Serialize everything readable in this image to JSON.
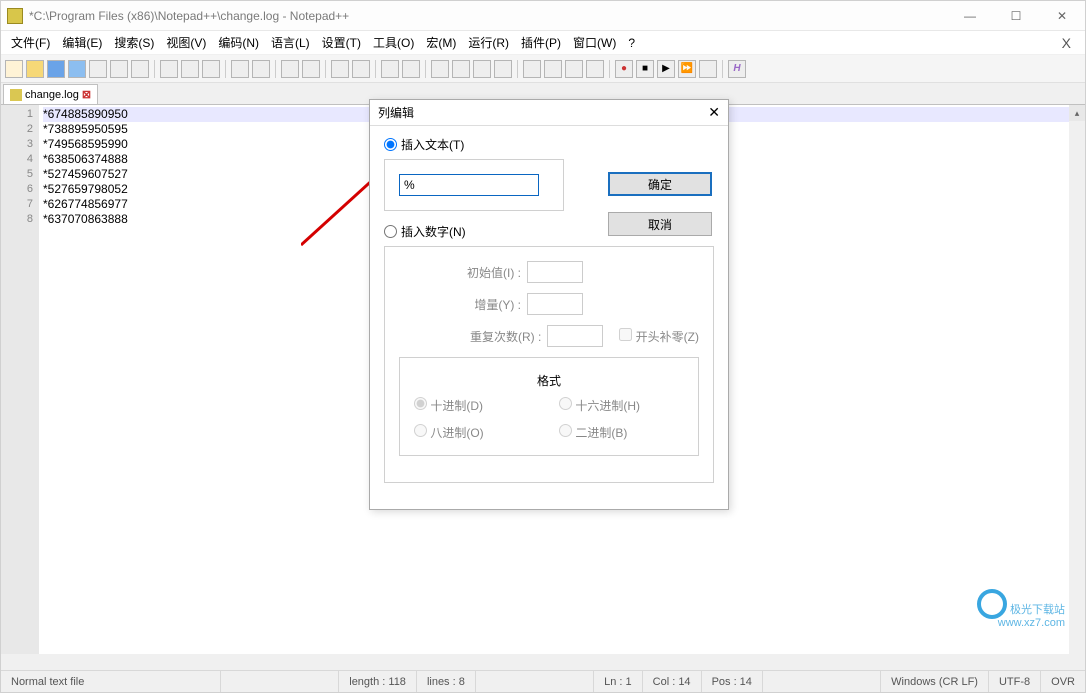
{
  "titlebar": {
    "title": "*C:\\Program Files (x86)\\Notepad++\\change.log - Notepad++"
  },
  "menus": [
    {
      "label": "文件(F)"
    },
    {
      "label": "编辑(E)"
    },
    {
      "label": "搜索(S)"
    },
    {
      "label": "视图(V)"
    },
    {
      "label": "编码(N)"
    },
    {
      "label": "语言(L)"
    },
    {
      "label": "设置(T)"
    },
    {
      "label": "工具(O)"
    },
    {
      "label": "宏(M)"
    },
    {
      "label": "运行(R)"
    },
    {
      "label": "插件(P)"
    },
    {
      "label": "窗口(W)"
    },
    {
      "label": "?"
    }
  ],
  "tab": {
    "name": "change.log"
  },
  "code_lines": [
    "*674885890950",
    "*738895950595",
    "*749568595990",
    "*638506374888",
    "*527459607527",
    "*527659798052",
    "*626774856977",
    "*637070863888"
  ],
  "dialog": {
    "title": "列编辑",
    "insert_text_label": "插入文本(T)",
    "text_value": "%",
    "insert_number_label": "插入数字(N)",
    "initial_label": "初始值(I) :",
    "increment_label": "增量(Y) :",
    "repeat_label": "重复次数(R) :",
    "pad_label": "开头补零(Z)",
    "format_label": "格式",
    "dec_label": "十进制(D)",
    "hex_label": "十六进制(H)",
    "oct_label": "八进制(O)",
    "bin_label": "二进制(B)",
    "ok": "确定",
    "cancel": "取消"
  },
  "status": {
    "filetype": "Normal text file",
    "length_label": "length : 118",
    "lines_label": "lines : 8",
    "ln_label": "Ln : 1",
    "col_label": "Col : 14",
    "pos_label": "Pos : 14",
    "eol": "Windows (CR LF)",
    "encoding": "UTF-8",
    "ovr": "OVR"
  },
  "watermark": {
    "line1": "极光下载站",
    "line2": "www.xz7.com"
  }
}
